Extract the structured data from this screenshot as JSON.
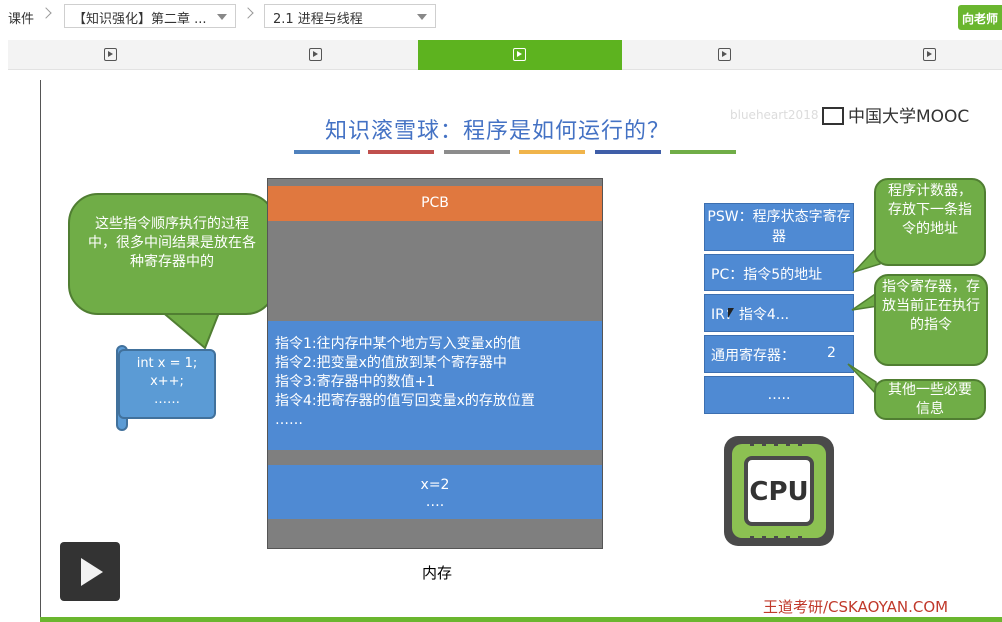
{
  "breadcrumb": {
    "root": "课件",
    "course_select": "【知识强化】第二章 ...",
    "lesson_select": "2.1 进程与线程",
    "ask_button": "向老师"
  },
  "tabs": [
    {
      "icon": "video-icon",
      "active": false
    },
    {
      "icon": "video-icon",
      "active": false
    },
    {
      "icon": "video-icon",
      "active": true
    },
    {
      "icon": "video-icon",
      "active": false
    },
    {
      "icon": "video-icon",
      "active": false
    }
  ],
  "slide": {
    "title": "知识滚雪球：程序是如何运行的？",
    "watermark": "blueheart2018",
    "brand": "中国大学MOOC",
    "color_bars": [
      "#4f81bd",
      "#c0504d",
      "#8c8c8c",
      "#f0b44b",
      "#3f5ea8",
      "#70ad47"
    ],
    "left_bubble": "这些指令顺序执行的过程中，很多中间结果是放在各种寄存器中的",
    "code_scroll": [
      "int x = 1;",
      "x++;",
      "……"
    ],
    "memory": {
      "pcb": "PCB",
      "instructions": [
        "指令1:往内存中某个地方写入变量x的值",
        "指令2:把变量x的值放到某个寄存器中",
        "指令3:寄存器中的数值+1",
        "指令4:把寄存器的值写回变量x的存放位置",
        "……"
      ],
      "data_line1": "x=2",
      "data_line2": "….",
      "label": "内存"
    },
    "registers": {
      "psw": "PSW：程序状态字寄存器",
      "pc": "PC：指令5的地址",
      "ir": "IR：指令4...",
      "general": "通用寄存器：",
      "general_value": "2",
      "more": "….."
    },
    "callouts": {
      "pc": "程序计数器，存放下一条指令的地址",
      "ir": "指令寄存器，存放当前正在执行的指令",
      "other": "其他一些必要信息"
    },
    "cpu_label": "CPU",
    "credit": "王道考研/CSKAOYAN.COM"
  },
  "colors": {
    "accent_green": "#5db31f",
    "register_blue": "#4f8ad3",
    "callout_green": "#70ad47",
    "pcb_orange": "#e0783f"
  }
}
